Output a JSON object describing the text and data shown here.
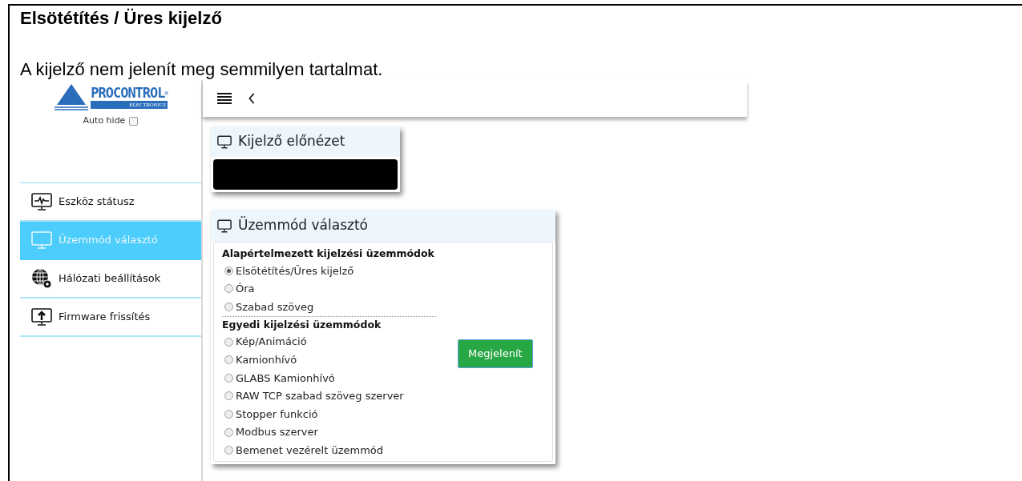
{
  "document": {
    "heading": "Elsötétítés / Üres kijelző",
    "paragraph": "A kijelző nem jelenít meg semmilyen tartalmat."
  },
  "logo": {
    "name": "PROCONTROL",
    "mark": "®",
    "sub": "ELECTRONICS"
  },
  "auto_hide": {
    "label": "Auto hide",
    "checked": false
  },
  "sidebar": {
    "items": [
      {
        "label": "Eszköz státusz",
        "kind": "status",
        "selected": false
      },
      {
        "label": "Üzemmód választó",
        "kind": "monitor",
        "selected": true
      },
      {
        "label": "Hálózati beállítások",
        "kind": "network",
        "selected": false
      },
      {
        "label": "Firmware frissítés",
        "kind": "upload",
        "selected": false
      }
    ]
  },
  "preview_card": {
    "title": "Kijelző előnézet"
  },
  "mode_card": {
    "title": "Üzemmód választó",
    "groups": [
      {
        "heading": "Alapértelmezett kijelzési üzemmódok",
        "options": [
          {
            "label": "Elsötétítés/Üres kijelző",
            "selected": true
          },
          {
            "label": "Óra",
            "selected": false
          },
          {
            "label": "Szabad szöveg",
            "selected": false
          }
        ]
      },
      {
        "heading": "Egyedi kijelzési üzemmódok",
        "options": [
          {
            "label": "Kép/Animáció",
            "selected": false
          },
          {
            "label": "Kamionhívó",
            "selected": false
          },
          {
            "label": "GLABS Kamionhívó",
            "selected": false
          },
          {
            "label": "RAW TCP szabad szöveg szerver",
            "selected": false
          },
          {
            "label": "Stopper funkció",
            "selected": false
          },
          {
            "label": "Modbus szerver",
            "selected": false
          },
          {
            "label": "Bemenet vezérelt üzemmód",
            "selected": false
          }
        ]
      }
    ],
    "button": "Megjelenít"
  }
}
